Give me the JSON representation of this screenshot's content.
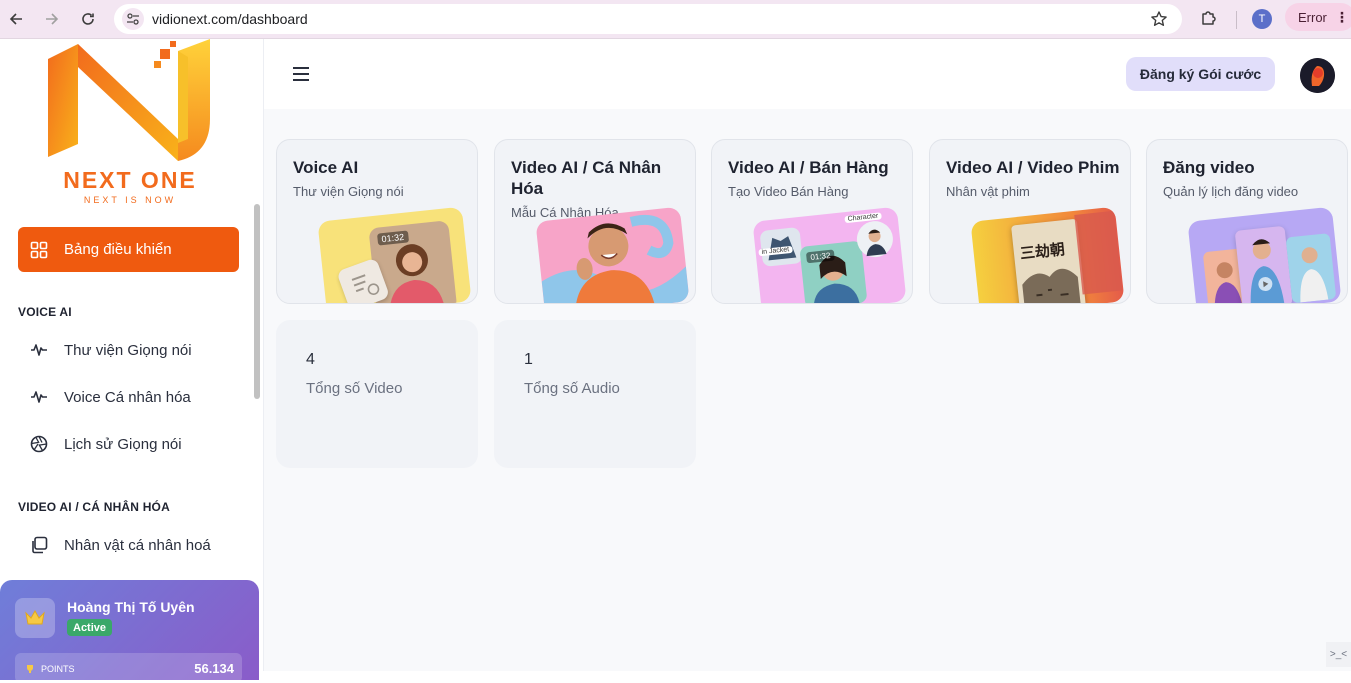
{
  "browser": {
    "url": "vidionext.com/dashboard",
    "profile_initial": "T",
    "error_label": "Error"
  },
  "sidebar": {
    "brand": "NEXT ONE",
    "tagline": "NEXT IS NOW",
    "active_item": "Bảng điều khiển",
    "sections": [
      {
        "title": "VOICE AI",
        "items": [
          "Thư viện Giọng nói",
          "Voice Cá nhân hóa",
          "Lịch sử Giọng nói"
        ]
      },
      {
        "title": "VIDEO AI / CÁ NHÂN HÓA",
        "items": [
          "Nhân vật cá nhân hoá"
        ]
      }
    ],
    "user": {
      "name": "Hoàng Thị Tố Uyên",
      "status": "Active",
      "points_label": "POINTS",
      "points_value": "56.134"
    }
  },
  "header": {
    "subscribe_label": "Đăng ký Gói cước"
  },
  "cards": [
    {
      "title": "Voice AI",
      "subtitle": "Thư viện Giọng nói",
      "accent": "#f8e27a",
      "art_time": "01:32"
    },
    {
      "title": "Video AI / Cá Nhân Hóa",
      "subtitle": "Mẫu Cá Nhân Hóa",
      "accent": "#f7a4c8"
    },
    {
      "title": "Video AI / Bán Hàng",
      "subtitle": "Tạo Video Bán Hàng",
      "accent": "#f3b5f0",
      "art_time": "01:32",
      "art_tag": "Character",
      "art_tag2": "in Jacket"
    },
    {
      "title": "Video AI / Video Phim",
      "subtitle": "Nhân vật phim",
      "accent": "#f4c24a",
      "art_text": "三劫朝"
    },
    {
      "title": "Đăng video",
      "subtitle": "Quản lý lịch đăng video",
      "accent": "#b7a8f4"
    }
  ],
  "stats": [
    {
      "value": "4",
      "label": "Tổng số Video"
    },
    {
      "value": "1",
      "label": "Tổng số Audio"
    }
  ],
  "corner_icon": ">_<"
}
